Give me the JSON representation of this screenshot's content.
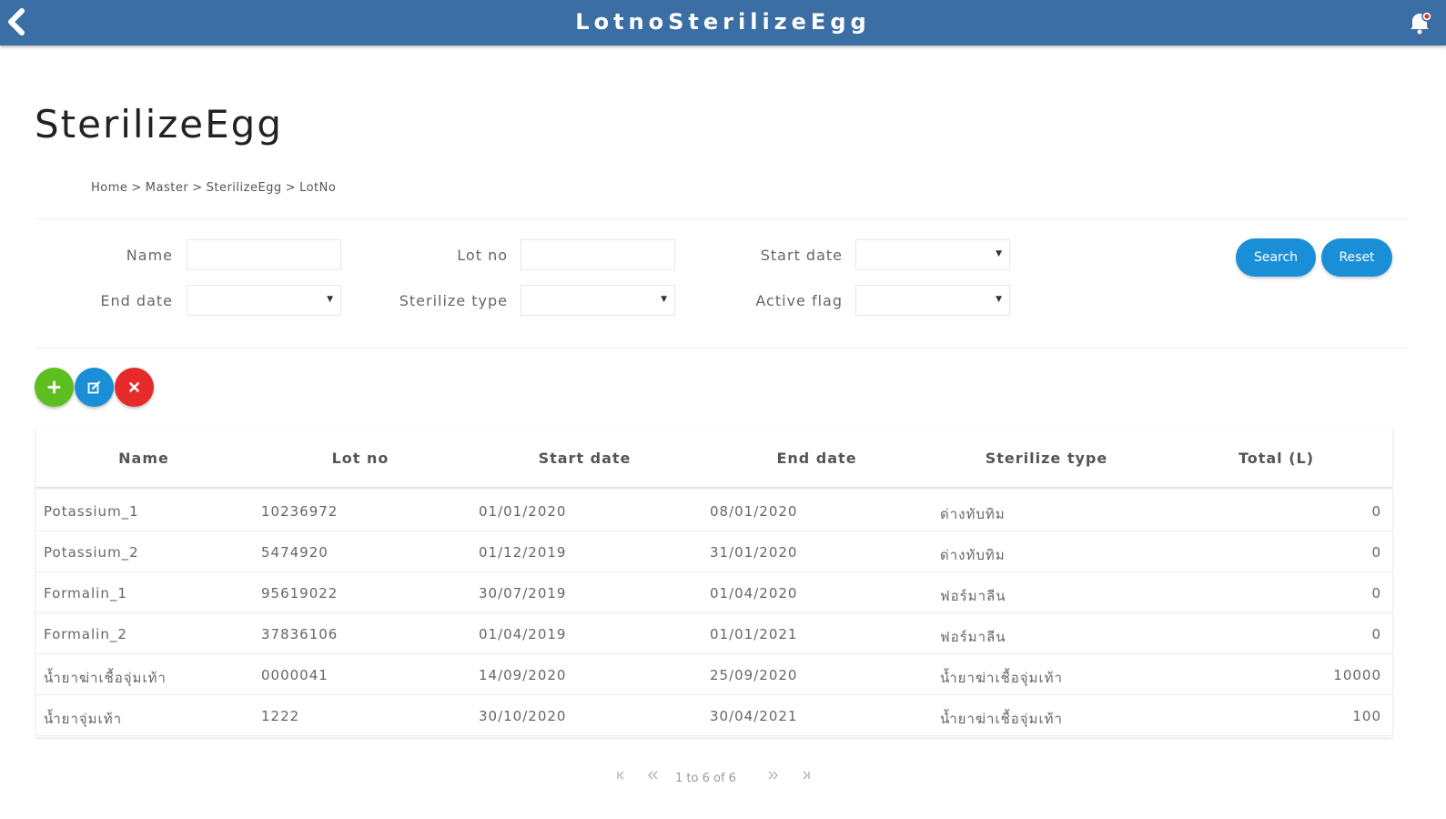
{
  "topbar": {
    "title": "LotnoSterilizeEgg",
    "back_icon": "back-arrow-icon",
    "bell_icon": "bell-icon"
  },
  "page": {
    "title": "SterilizeEgg",
    "breadcrumb": [
      "Home",
      "Master",
      "SterilizeEgg",
      "LotNo"
    ],
    "breadcrumb_separator": ">"
  },
  "filters": {
    "name_label": "Name",
    "name_value": "",
    "lotno_label": "Lot no",
    "lotno_value": "",
    "startdate_label": "Start date",
    "startdate_value": "",
    "enddate_label": "End date",
    "enddate_value": "",
    "sterilizetype_label": "Sterilize type",
    "sterilizetype_value": "",
    "activeflag_label": "Active flag",
    "activeflag_value": "",
    "search_label": "Search",
    "reset_label": "Reset"
  },
  "actions": {
    "add_icon": "plus-icon",
    "edit_icon": "edit-icon",
    "delete_icon": "close-icon"
  },
  "colors": {
    "header": "#3a6ea5",
    "primary": "#1a8fd8",
    "add": "#5cbf1f",
    "edit": "#1a8fd8",
    "delete": "#e52a2a"
  },
  "table": {
    "columns": [
      "Name",
      "Lot no",
      "Start date",
      "End date",
      "Sterilize type",
      "Total (L)"
    ],
    "rows": [
      [
        "Potassium_1",
        "10236972",
        "01/01/2020",
        "08/01/2020",
        "ด่างทับทิม",
        "0"
      ],
      [
        "Potassium_2",
        "5474920",
        "01/12/2019",
        "31/01/2020",
        "ด่างทับทิม",
        "0"
      ],
      [
        "Formalin_1",
        "95619022",
        "30/07/2019",
        "01/04/2020",
        "ฟอร์มาลีน",
        "0"
      ],
      [
        "Formalin_2",
        "37836106",
        "01/04/2019",
        "01/01/2021",
        "ฟอร์มาลีน",
        "0"
      ],
      [
        "น้ำยาฆ่าเชื้อจุ่มเท้า",
        "0000041",
        "14/09/2020",
        "25/09/2020",
        "น้ำยาฆ่าเชื้อจุ่มเท้า",
        "10000"
      ],
      [
        "น้ำยาจุ่มเท้า",
        "1222",
        "30/10/2020",
        "30/04/2021",
        "น้ำยาฆ่าเชื้อจุ่มเท้า",
        "100"
      ]
    ]
  },
  "pagination": {
    "summary": "1 to 6 of 6",
    "first_icon": "first-page-icon",
    "prev_icon": "prev-page-icon",
    "next_icon": "next-page-icon",
    "last_icon": "last-page-icon"
  }
}
